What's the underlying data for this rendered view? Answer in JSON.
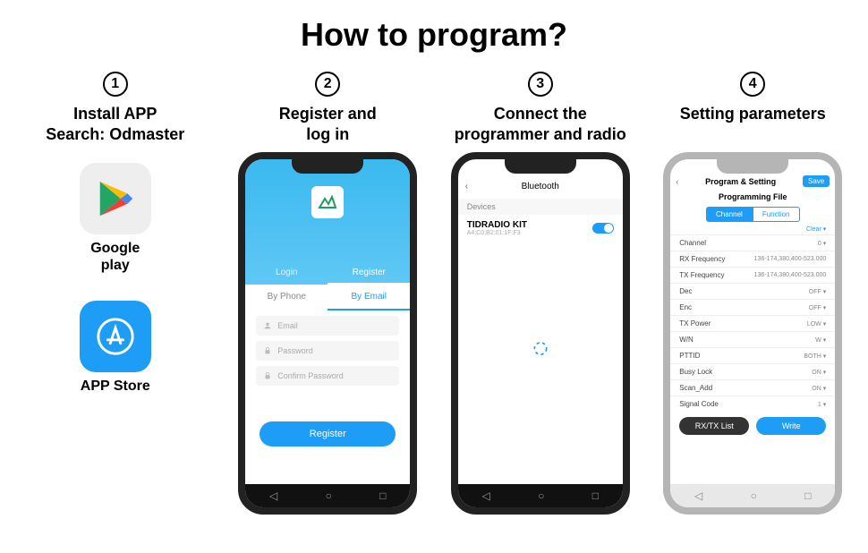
{
  "title": "How to program?",
  "steps": [
    {
      "num": "1",
      "label": "Install APP\nSearch: Odmaster"
    },
    {
      "num": "2",
      "label": "Register and\nlog in"
    },
    {
      "num": "3",
      "label": "Connect the\nprogrammer and radio"
    },
    {
      "num": "4",
      "label": "Setting parameters"
    }
  ],
  "stores": {
    "google": "Google\nplay",
    "appstore": "APP Store"
  },
  "register": {
    "login_tab": "Login",
    "register_tab": "Register",
    "by_phone": "By Phone",
    "by_email": "By Email",
    "email_ph": "Email",
    "pass_ph": "Password",
    "confirm_ph": "Confirm Password",
    "btn": "Register"
  },
  "bluetooth": {
    "title": "Bluetooth",
    "section": "Devices",
    "device_name": "TIDRADIO KIT",
    "device_mac": "A4:C0:B2:01:1F:F3"
  },
  "settings": {
    "header": "Program & Setting",
    "save": "Save",
    "subtitle": "Programming File",
    "seg_channel": "Channel",
    "seg_function": "Function",
    "clear": "Clear",
    "rows": [
      {
        "k": "Channel",
        "v": "0 ▾"
      },
      {
        "k": "RX Frequency",
        "v": "136-174,380,400-523.000"
      },
      {
        "k": "TX Frequency",
        "v": "136-174,380,400-523.000"
      },
      {
        "k": "Dec",
        "v": "OFF ▾"
      },
      {
        "k": "Enc",
        "v": "OFF ▾"
      },
      {
        "k": "TX Power",
        "v": "LOW ▾"
      },
      {
        "k": "W/N",
        "v": "W ▾"
      },
      {
        "k": "PTTID",
        "v": "BOTH ▾"
      },
      {
        "k": "Busy Lock",
        "v": "ON ▾"
      },
      {
        "k": "Scan_Add",
        "v": "ON ▾"
      },
      {
        "k": "Signal Code",
        "v": "1 ▾"
      }
    ],
    "rxtx_btn": "RX/TX List",
    "write_btn": "Write"
  }
}
